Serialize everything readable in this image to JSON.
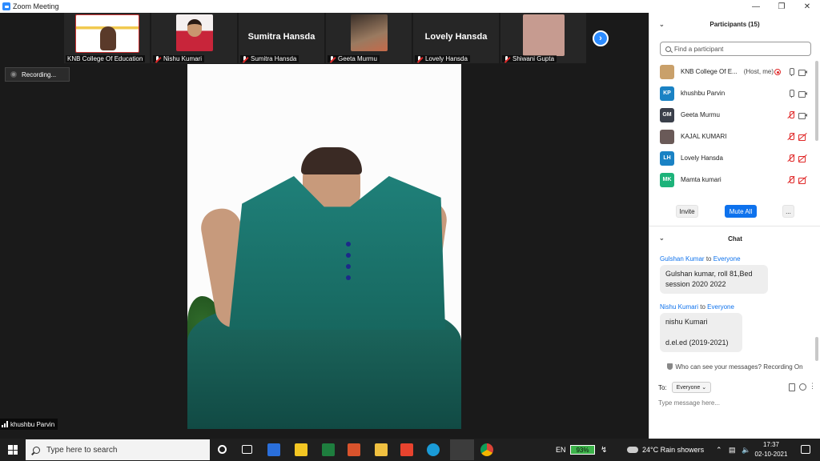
{
  "window": {
    "title": "Zoom Meeting",
    "controls": [
      "minimize",
      "maximize",
      "close"
    ]
  },
  "thumbnails": [
    {
      "name": "KNB College Of Education",
      "muted": false,
      "type": "video-ppt"
    },
    {
      "name": "Nishu Kumari",
      "muted": true,
      "type": "video-nishu"
    },
    {
      "name": "Sumitra Hansda",
      "muted": true,
      "type": "text",
      "big_name": "Sumitra Hansda"
    },
    {
      "name": "Geeta Murmu",
      "muted": true,
      "type": "video-geeta"
    },
    {
      "name": "Lovely Hansda",
      "muted": true,
      "type": "text",
      "big_name": "Lovely Hansda"
    },
    {
      "name": "Shiwani Gupta",
      "muted": true,
      "type": "video-shiwani"
    }
  ],
  "recording_label": "Recording...",
  "active_speaker": "khushbu Parvin",
  "participants": {
    "title": "Participants (15)",
    "search_placeholder": "Find a participant",
    "list": [
      {
        "initials": "",
        "name": "KNB College Of E...",
        "tag": "(Host, me)",
        "avatar_color": "#c9a06a",
        "rec": true,
        "mic": "on",
        "cam": "on"
      },
      {
        "initials": "KP",
        "name": "khushbu Parvin",
        "tag": "",
        "avatar_color": "#1a82c4",
        "rec": false,
        "mic": "on",
        "cam": "on"
      },
      {
        "initials": "GM",
        "name": "Geeta Murmu",
        "tag": "",
        "avatar_color": "#3a3f4a",
        "rec": false,
        "mic": "off",
        "cam": "on"
      },
      {
        "initials": "",
        "name": "KAJAL KUMARI",
        "tag": "",
        "avatar_color": "#6a5a58",
        "rec": false,
        "mic": "off",
        "cam": "off"
      },
      {
        "initials": "LH",
        "name": "Lovely Hansda",
        "tag": "",
        "avatar_color": "#1a82c4",
        "rec": false,
        "mic": "off",
        "cam": "off"
      },
      {
        "initials": "MK",
        "name": "Mamta kumari",
        "tag": "",
        "avatar_color": "#1db37a",
        "rec": false,
        "mic": "off",
        "cam": "off"
      }
    ],
    "buttons": {
      "invite": "Invite",
      "mute_all": "Mute All",
      "more": "..."
    }
  },
  "chat": {
    "title": "Chat",
    "messages": [
      {
        "from": "Gulshan Kumar",
        "to_label": "to",
        "to": "Everyone",
        "text": "Gulshan kumar, roll 81,Bed\nsession 2020 2022"
      },
      {
        "from": "Nishu Kumari",
        "to_label": "to",
        "to": "Everyone",
        "text": "nishu Kumari\n\nd.el.ed  (2019-2021)"
      }
    ],
    "privacy_note": "Who can see your messages? Recording On",
    "to_label": "To:",
    "to_value": "Everyone",
    "input_placeholder": "Type message here..."
  },
  "taskbar": {
    "search_text": "Type here to search",
    "language": "EN",
    "battery": "93%",
    "weather": "24°C  Rain showers",
    "time": "17:37",
    "date": "02-10-2021"
  },
  "colors": {
    "accent": "#2d8cff",
    "zoom_blue": "#0e72ed",
    "muted_red": "#e02828"
  }
}
